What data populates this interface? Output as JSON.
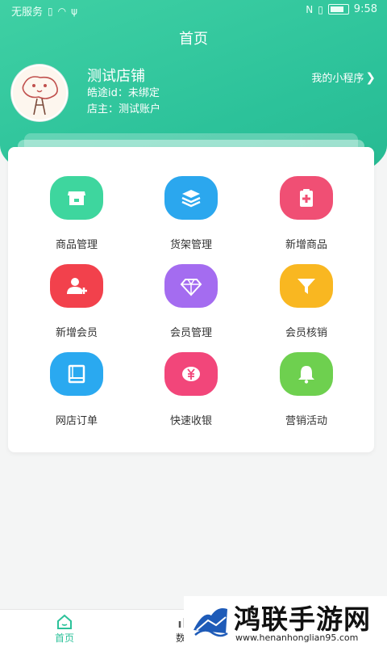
{
  "status_bar": {
    "carrier": "无服务",
    "time": "9:58"
  },
  "header": {
    "title": "首页",
    "store_name": "测试店铺",
    "store_id": "皓途id：未绑定",
    "store_owner": "店主：测试账户",
    "mini_program": "我的小程序"
  },
  "menu": [
    {
      "label": "商品管理",
      "icon": "store-icon",
      "color": "#3ed69e"
    },
    {
      "label": "货架管理",
      "icon": "layers-icon",
      "color": "#2ba7ee"
    },
    {
      "label": "新增商品",
      "icon": "clipboard-plus-icon",
      "color": "#f04f74"
    },
    {
      "label": "新增会员",
      "icon": "user-add-icon",
      "color": "#f2414c"
    },
    {
      "label": "会员管理",
      "icon": "diamond-icon",
      "color": "#a46cf0"
    },
    {
      "label": "会员核销",
      "icon": "filter-icon",
      "color": "#f9b721"
    },
    {
      "label": "网店订单",
      "icon": "book-icon",
      "color": "#2aa9f0"
    },
    {
      "label": "快速收银",
      "icon": "yen-icon",
      "color": "#f2467a"
    },
    {
      "label": "营销活动",
      "icon": "bell-icon",
      "color": "#6ed04f"
    }
  ],
  "bottom_nav": {
    "home": "首页",
    "data": "数据"
  },
  "watermark": {
    "title": "鸿联手游网",
    "url": "www.henanhonglian95.com"
  },
  "colors": {
    "brand": "#2cc29a",
    "header_gradient_start": "#3fd0a4"
  }
}
